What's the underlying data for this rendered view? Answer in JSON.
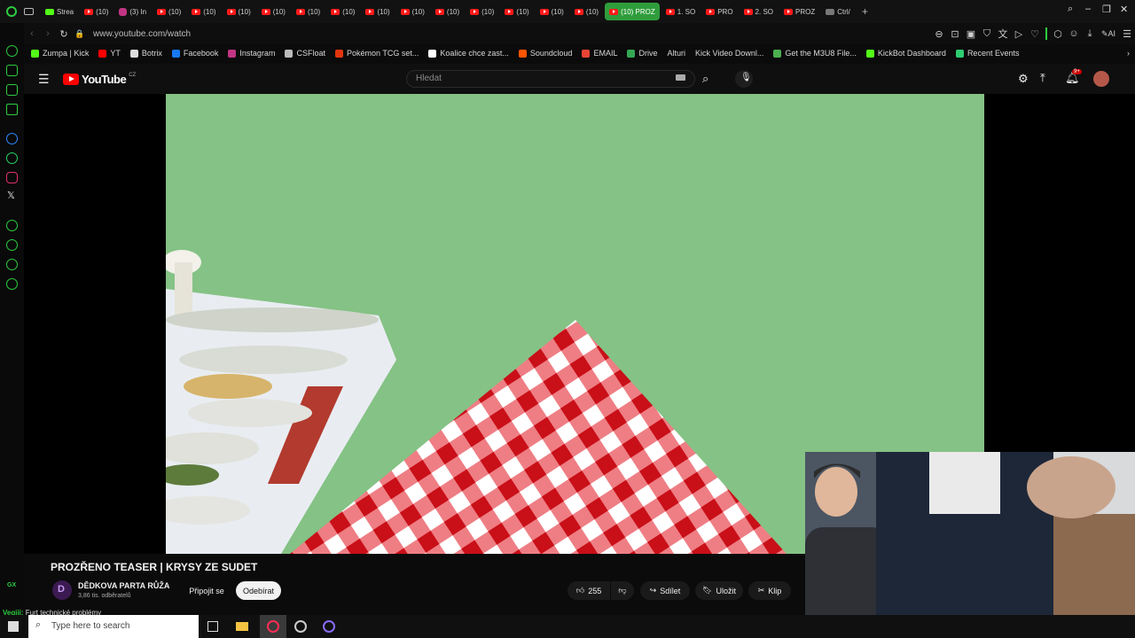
{
  "browser": {
    "tabs": [
      {
        "label": "Strea",
        "icon": "kick-icon"
      },
      {
        "label": "(10)",
        "icon": "youtube-icon"
      },
      {
        "label": "(3) In",
        "icon": "instagram-icon"
      },
      {
        "label": "(10)",
        "icon": "youtube-icon"
      },
      {
        "label": "(10)",
        "icon": "youtube-icon"
      },
      {
        "label": "(10)",
        "icon": "youtube-icon"
      },
      {
        "label": "(10)",
        "icon": "youtube-icon"
      },
      {
        "label": "(10)",
        "icon": "youtube-icon"
      },
      {
        "label": "(10)",
        "icon": "youtube-icon"
      },
      {
        "label": "(10)",
        "icon": "youtube-icon"
      },
      {
        "label": "(10)",
        "icon": "youtube-icon"
      },
      {
        "label": "(10)",
        "icon": "youtube-icon"
      },
      {
        "label": "(10)",
        "icon": "youtube-icon"
      },
      {
        "label": "(10)",
        "icon": "youtube-icon"
      },
      {
        "label": "(10)",
        "icon": "youtube-icon"
      },
      {
        "label": "(10)",
        "icon": "youtube-icon"
      },
      {
        "label": "(10) PROZ",
        "icon": "youtube-icon",
        "active": true
      },
      {
        "label": "1. SO",
        "icon": "youtube-icon"
      },
      {
        "label": "PRO",
        "icon": "youtube-icon"
      },
      {
        "label": "2. SO",
        "icon": "youtube-icon"
      },
      {
        "label": "PROZ",
        "icon": "youtube-icon"
      },
      {
        "label": "Ctrl/",
        "icon": "v-icon"
      }
    ],
    "url": "www.youtube.com/watch",
    "bookmarks": [
      {
        "label": "Zumpa | Kick",
        "color": "#53fc18"
      },
      {
        "label": "YT",
        "color": "#ff0000"
      },
      {
        "label": "Botrix",
        "color": "#dddddd"
      },
      {
        "label": "Facebook",
        "color": "#1877f2"
      },
      {
        "label": "Instagram",
        "color": "#c13584"
      },
      {
        "label": "CSFloat",
        "color": "#bbbbbb"
      },
      {
        "label": "Pokémon TCG set...",
        "color": "#e3350d"
      },
      {
        "label": "Koalice chce zast...",
        "color": "#ffffff"
      },
      {
        "label": "Soundcloud",
        "color": "#ff5500"
      },
      {
        "label": "EMAIL",
        "color": "#ea4335"
      },
      {
        "label": "Drive",
        "color": "#34a853"
      },
      {
        "label": "Alturi",
        "color": ""
      },
      {
        "label": "Kick Video Downl...",
        "color": ""
      },
      {
        "label": "Get the M3U8 File...",
        "color": "#4caf50"
      },
      {
        "label": "KickBot Dashboard",
        "color": "#53fc18"
      },
      {
        "label": "Recent Events",
        "color": "#2ecc71"
      }
    ]
  },
  "youtube": {
    "logo_text": "YouTube",
    "region": "CZ",
    "search_placeholder": "Hledat",
    "notification_badge": "9+",
    "video": {
      "title": "PROZŘENO TEASER | KRYSY ZE SUDET",
      "channel_name": "DĚDKOVA PARTA RŮŽA",
      "subscribers": "3,86 tis. odběratelů",
      "join_label": "Připojit se",
      "subscribe_label": "Odebírat",
      "likes": "255",
      "share_label": "Sdílet",
      "save_label": "Uložit",
      "clip_label": "Klip"
    }
  },
  "overlay": {
    "chat_user": "Vegiii:",
    "chat_message": "Furt technické problémy",
    "sidebar_label": "GX"
  },
  "taskbar": {
    "search_placeholder": "Type here to search"
  },
  "colors": {
    "accent_green": "#2f9d3c",
    "youtube_red": "#ff0000",
    "video_bg": "#85c285"
  }
}
